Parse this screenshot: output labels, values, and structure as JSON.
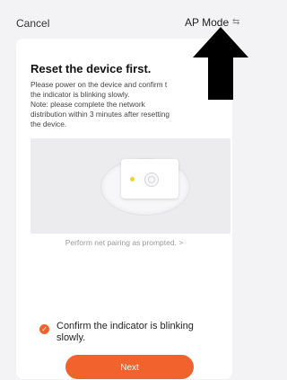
{
  "header": {
    "cancel_label": "Cancel",
    "mode_label": "AP Mode",
    "mode_icon": "⇆"
  },
  "card": {
    "title": "Reset the device first.",
    "description_lines": [
      "Please power on the device and confirm t",
      "the indicator is blinking slowly.",
      "Note: please complete the network",
      "distribution within 3 minutes after resetting",
      "the device."
    ],
    "prompt": "Perform net pairing as prompted. >",
    "confirm_text": "Confirm the indicator is blinking slowly.",
    "next_label": "Next"
  },
  "colors": {
    "accent": "#f1622c",
    "background": "#f3f3f5",
    "card": "#ffffff",
    "led": "#f3d21f"
  }
}
